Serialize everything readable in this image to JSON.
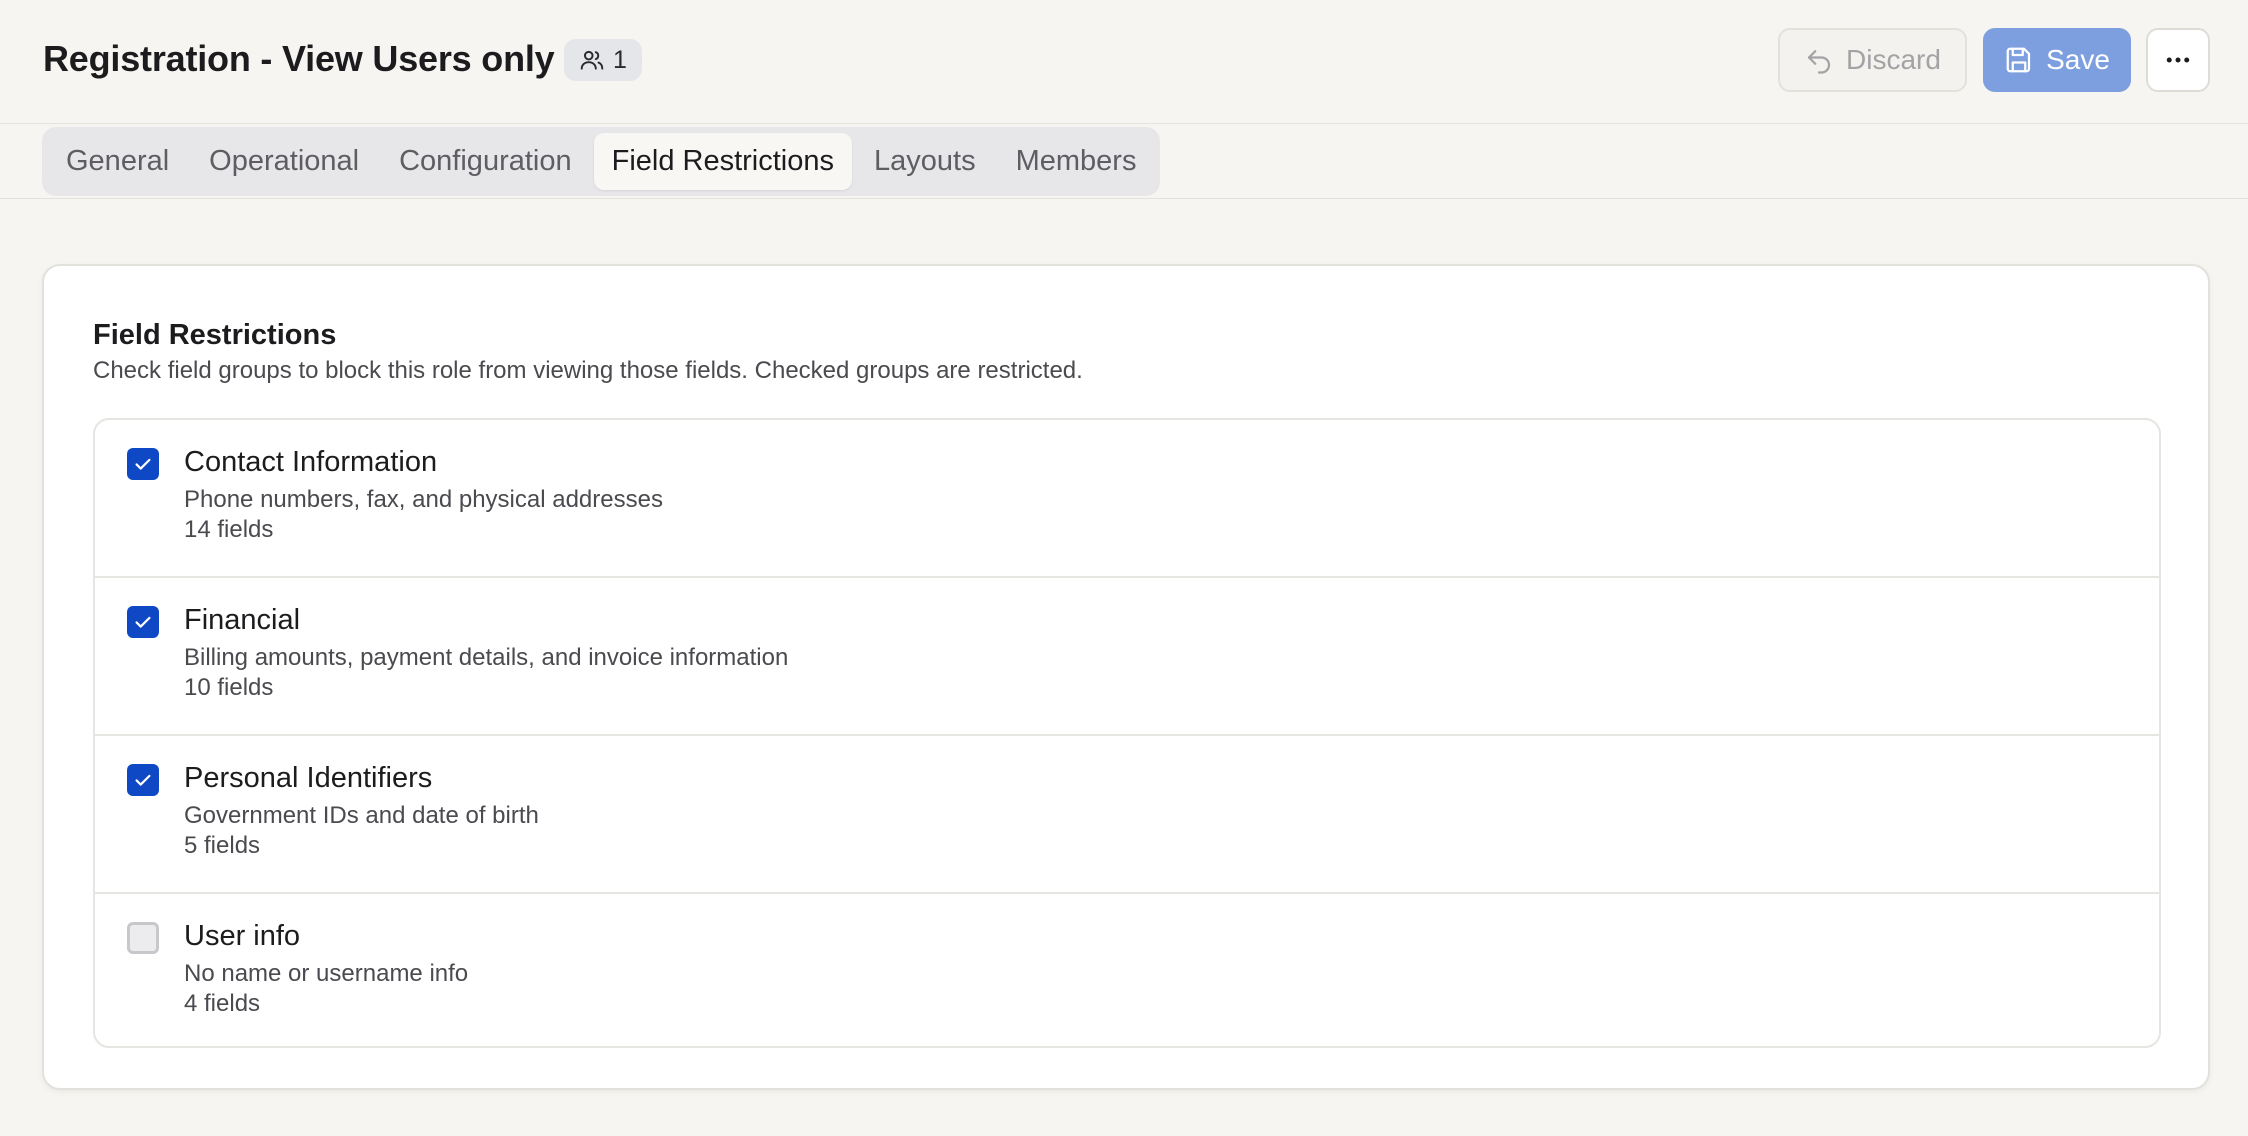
{
  "header": {
    "title": "Registration - View Users only",
    "member_count": "1",
    "discard_label": "Discard",
    "save_label": "Save"
  },
  "tabs": [
    {
      "label": "General",
      "active": false
    },
    {
      "label": "Operational",
      "active": false
    },
    {
      "label": "Configuration",
      "active": false
    },
    {
      "label": "Field Restrictions",
      "active": true
    },
    {
      "label": "Layouts",
      "active": false
    },
    {
      "label": "Members",
      "active": false
    }
  ],
  "section": {
    "title": "Field Restrictions",
    "description": "Check field groups to block this role from viewing those fields. Checked groups are restricted."
  },
  "groups": [
    {
      "name": "Contact Information",
      "description": "Phone numbers, fax, and physical addresses",
      "count": "14 fields",
      "checked": true
    },
    {
      "name": "Financial",
      "description": "Billing amounts, payment details, and invoice information",
      "count": "10 fields",
      "checked": true
    },
    {
      "name": "Personal Identifiers",
      "description": "Government IDs and date of birth",
      "count": "5 fields",
      "checked": true
    },
    {
      "name": "User info",
      "description": "No name or username info",
      "count": "4 fields",
      "checked": false
    }
  ],
  "colors": {
    "accent": "#0f48c5",
    "save_button": "#7d9fdf",
    "background": "#f6f5f1"
  },
  "icons": {
    "members": "users-icon",
    "discard": "undo-icon",
    "save": "floppy-disk-icon",
    "more": "more-horizontal-icon",
    "check": "check-icon"
  }
}
